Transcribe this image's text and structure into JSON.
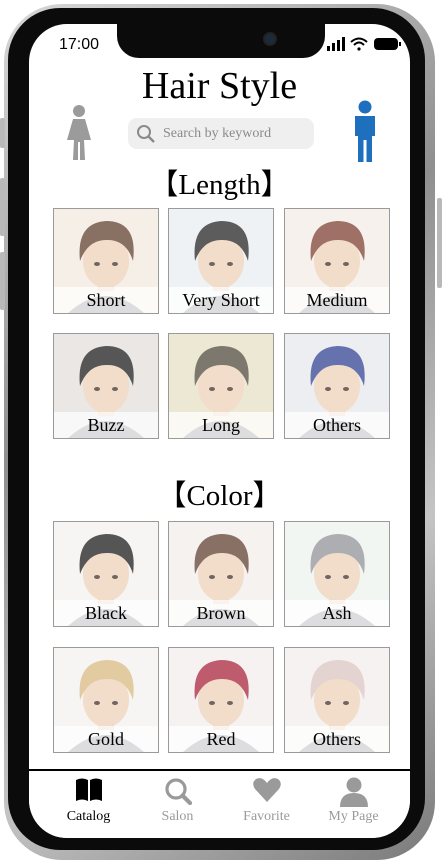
{
  "status_bar": {
    "time": "17:00"
  },
  "header": {
    "title": "Hair Style",
    "female_icon_color": "#9b9b9b",
    "male_icon_color": "#1f6fbf"
  },
  "search": {
    "placeholder": "Search by keyword",
    "icon": "search-icon"
  },
  "length_section": {
    "title": "【Length】",
    "items": [
      {
        "label": "Short",
        "hair": "#5a3a28",
        "bg": "#f1e9de"
      },
      {
        "label": "Very Short",
        "hair": "#1e1e1e",
        "bg": "#e9edf1"
      },
      {
        "label": "Medium",
        "hair": "#7a3a2c",
        "bg": "#f4ece6"
      },
      {
        "label": "Buzz",
        "hair": "#151515",
        "bg": "#e2dedb"
      },
      {
        "label": "Long",
        "hair": "#4b4535",
        "bg": "#e6dfc2"
      },
      {
        "label": "Others",
        "hair": "#2a3c8f",
        "bg": "#e7e8ec"
      }
    ]
  },
  "color_section": {
    "title": "【Color】",
    "items": [
      {
        "label": "Black",
        "hair": "#141414",
        "bg": "#f3f1ef"
      },
      {
        "label": "Brown",
        "hair": "#5b3a2a",
        "bg": "#f2ede9"
      },
      {
        "label": "Ash",
        "hair": "#8c8f93",
        "bg": "#eef3ee"
      },
      {
        "label": "Gold",
        "hair": "#d8b77d",
        "bg": "#f4f2ef"
      },
      {
        "label": "Red",
        "hair": "#a51e35",
        "bg": "#f3eeee"
      },
      {
        "label": "Others",
        "hair": "#d9c3c0",
        "bg": "#f2eeec"
      }
    ]
  },
  "tab_bar": {
    "active_color": "#000000",
    "inactive_color": "#9a9a9a",
    "tabs": [
      {
        "label": "Catalog",
        "icon": "book-icon",
        "active": true
      },
      {
        "label": "Salon",
        "icon": "search-icon",
        "active": false
      },
      {
        "label": "Favorite",
        "icon": "heart-icon",
        "active": false
      },
      {
        "label": "My Page",
        "icon": "user-icon",
        "active": false
      }
    ]
  }
}
